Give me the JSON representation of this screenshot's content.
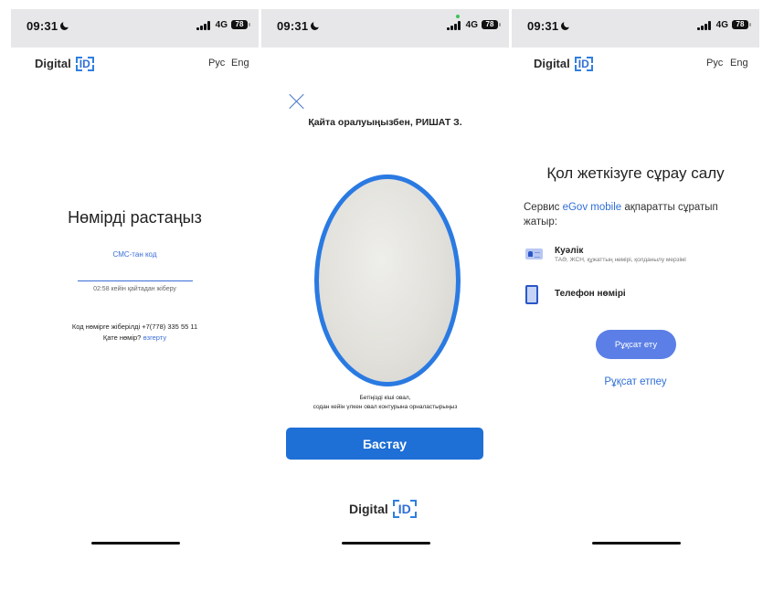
{
  "status": {
    "time": "09:31",
    "network": "4G",
    "battery": "78"
  },
  "brand": {
    "name": "Digital",
    "badge": "ID"
  },
  "lang": {
    "ru": "Рус",
    "en": "Eng"
  },
  "screen1": {
    "title": "Нөмірді растаңыз",
    "sms_label": "СМС-тан код",
    "resend_timer": "02:58 кейін қайтадан жіберу",
    "sent_to": "Код нөмірге жіберілді +7(778) 335 55 11",
    "wrong_number": "Қате нөмір?",
    "change_link": "өзгерту"
  },
  "screen2": {
    "welcome": "Қайта оралуыңызбен, РИШАТ З.",
    "hint_line1": "Бетіңізді кіші овал,",
    "hint_line2": "содан кейін үлкен овал контурына орналастырыңыз",
    "start_button": "Бастау"
  },
  "screen3": {
    "title": "Қол жеткізуге сұрау салу",
    "service_prefix": "Сервис",
    "service_name": "eGov mobile",
    "service_suffix": "ақпаратты сұратып жатыр:",
    "items": [
      {
        "label": "Куәлік",
        "sub": "ТАӘ, ЖСН, құжаттың нөмірі, қолданылу мерзімі",
        "icon": "id-card-icon"
      },
      {
        "label": "Телефон нөмірі",
        "sub": "",
        "icon": "phone-icon"
      }
    ],
    "allow_button": "Рұқсат ету",
    "deny_link": "Рұқсат етпеу"
  },
  "colors": {
    "accent": "#2f6fd6",
    "button": "#1e6fd6",
    "pill": "#5b7fe6",
    "oval_border": "#2a7ae2"
  }
}
